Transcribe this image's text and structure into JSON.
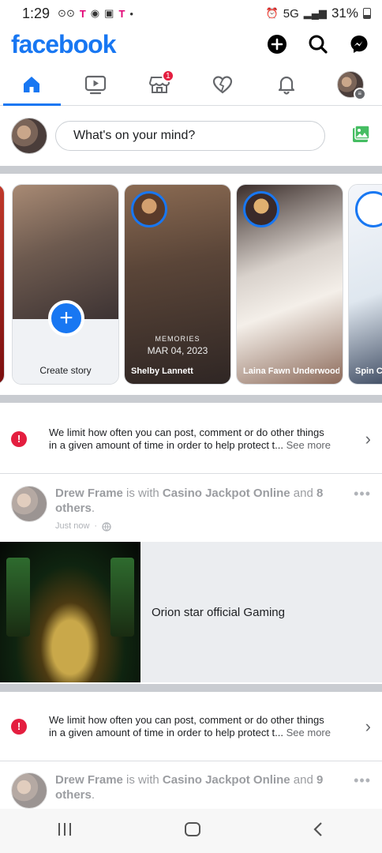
{
  "status_bar": {
    "time": "1:29",
    "network": "5G",
    "battery": "31%"
  },
  "header": {
    "logo": "facebook"
  },
  "tabs": [
    {
      "name": "home",
      "active": true
    },
    {
      "name": "watch"
    },
    {
      "name": "marketplace",
      "badge": "1"
    },
    {
      "name": "dating"
    },
    {
      "name": "notifications"
    },
    {
      "name": "menu"
    }
  ],
  "composer": {
    "placeholder": "What's on your mind?"
  },
  "stories": [
    {
      "label": "Create story"
    },
    {
      "name": "Shelby Lannett",
      "memory_label": "MEMORIES",
      "memory_date": "MAR 04, 2023"
    },
    {
      "name": "Laina Fawn Underwood"
    },
    {
      "name": "Spin C"
    }
  ],
  "notices": [
    {
      "text": "We limit how often you can post, comment or do other things in a given amount of time in order to help protect t...",
      "see_more": "See more"
    },
    {
      "text": "We limit how often you can post, comment or do other things in a given amount of time in order to help protect t...",
      "see_more": "See more"
    }
  ],
  "posts": [
    {
      "author": "Drew Frame",
      "with_text": " is with ",
      "page": "Casino Jackpot Online",
      "and_text": " and ",
      "others": "8 others",
      "period": ".",
      "time": "Just now",
      "link_title": "Orion star official Gaming"
    },
    {
      "author": "Drew Frame",
      "with_text": " is with ",
      "page": "Casino Jackpot Online",
      "and_text": " and ",
      "others": "9 others",
      "period": "."
    }
  ],
  "colors": {
    "brand": "#1877f2",
    "alert": "#e41e3f"
  }
}
